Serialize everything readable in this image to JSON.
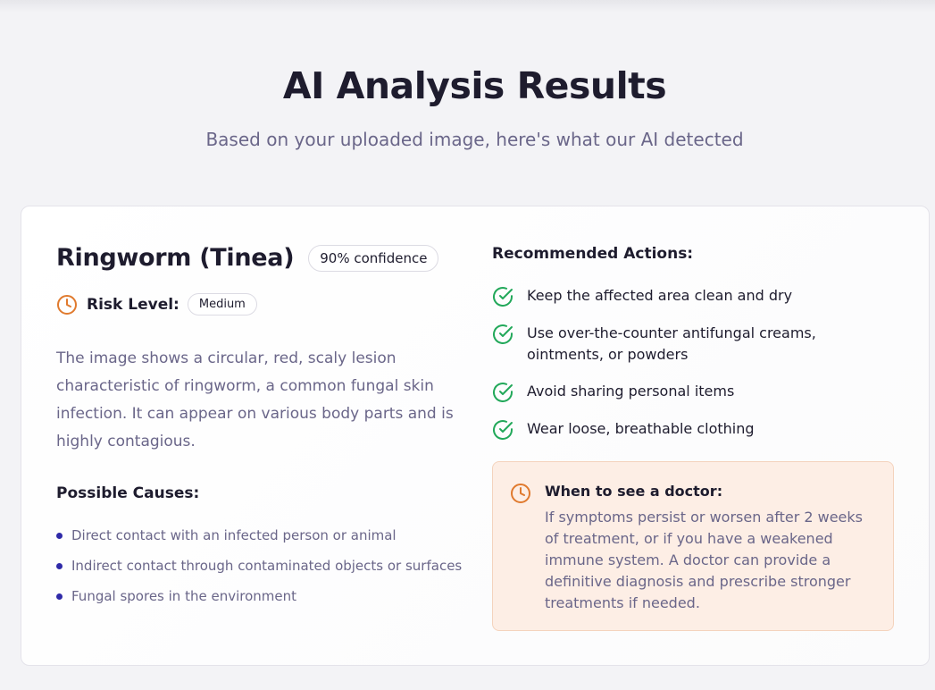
{
  "header": {
    "title": "AI Analysis Results",
    "subtitle": "Based on your uploaded image, here's what our AI detected"
  },
  "result": {
    "condition": "Ringworm (Tinea)",
    "confidence_label": "90% confidence",
    "risk_label": "Risk Level:",
    "risk_value": "Medium",
    "description": "The image shows a circular, red, scaly lesion characteristic of ringworm, a common fungal skin infection. It can appear on various body parts and is highly contagious.",
    "causes_heading": "Possible Causes:",
    "causes": [
      "Direct contact with an infected person or animal",
      "Indirect contact through contaminated objects or surfaces",
      "Fungal spores in the environment"
    ],
    "actions_heading": "Recommended Actions:",
    "actions": [
      "Keep the affected area clean and dry",
      "Use over-the-counter antifungal creams, ointments, or powders",
      "Avoid sharing personal items",
      "Wear loose, breathable clothing"
    ],
    "doctor": {
      "title": "When to see a doctor:",
      "text": "If symptoms persist or worsen after 2 weeks of treatment, or if you have a weakened immune system. A doctor can provide a definitive diagnosis and prescribe stronger treatments if needed."
    }
  },
  "icons": {
    "risk": "clock-icon",
    "action": "check-circle-icon",
    "doctor": "clock-icon"
  },
  "colors": {
    "accent_orange": "#e07a2e",
    "check_green": "#22a85a",
    "bullet_indigo": "#2f2aa8",
    "doctor_box_bg": "#fdeee5",
    "muted_text": "#6a6689"
  }
}
